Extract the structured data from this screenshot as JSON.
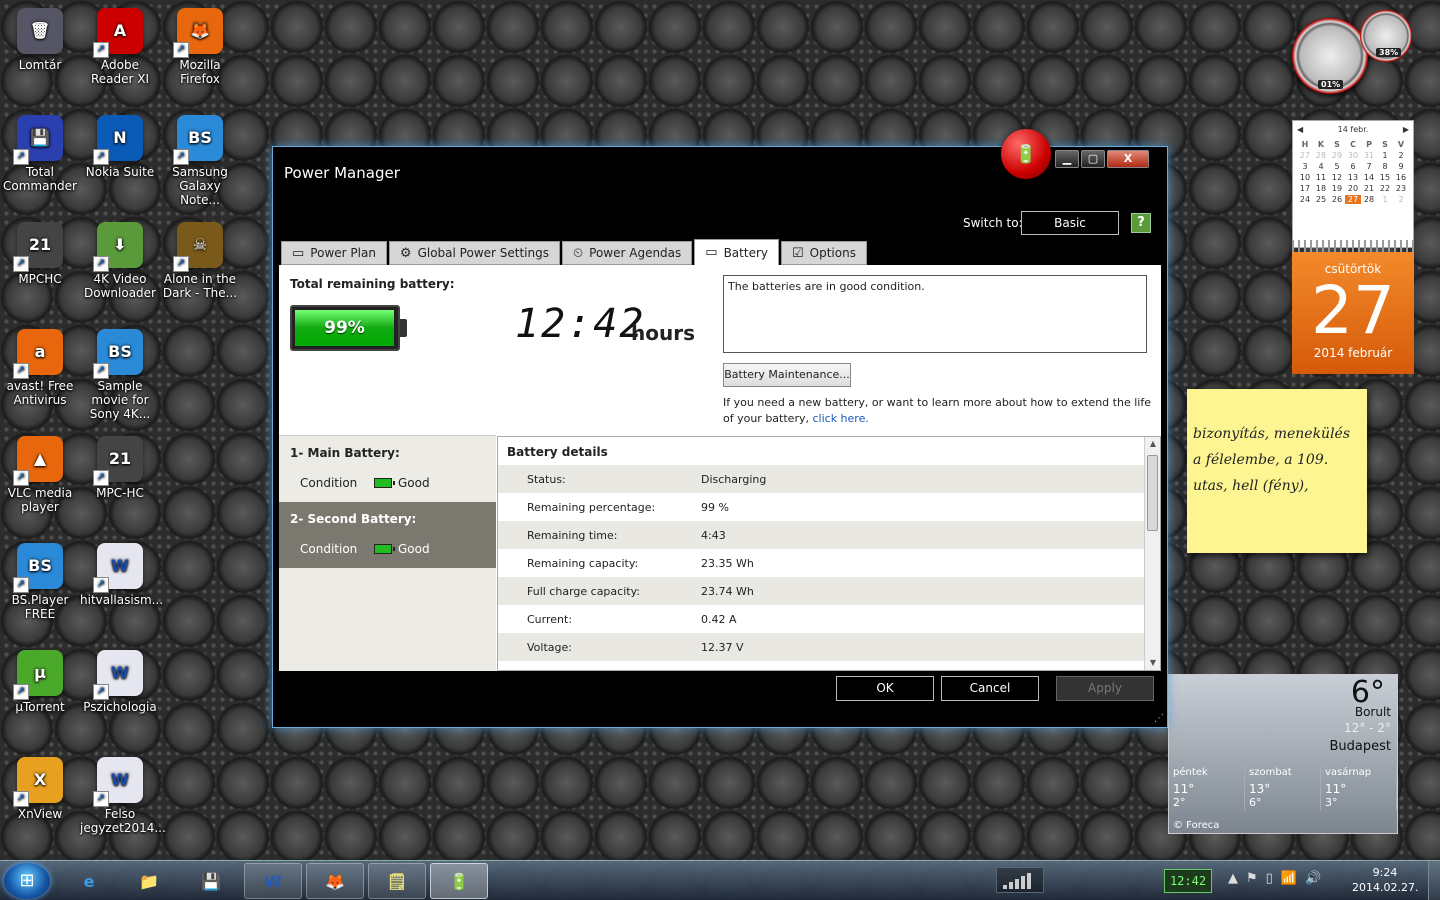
{
  "desktop_icons": [
    {
      "label": "Lomtár",
      "glyph": "🗑",
      "color": "#556"
    },
    {
      "label": "Adobe Reader XI",
      "glyph": "A",
      "color": "#c00"
    },
    {
      "label": "Mozilla Firefox",
      "glyph": "🦊",
      "color": "#e8670c"
    },
    {
      "label": "Total Commander",
      "glyph": "💾",
      "color": "#2a3fb0"
    },
    {
      "label": "Nokia Suite",
      "glyph": "N",
      "color": "#0a5ab8"
    },
    {
      "label": "Samsung Galaxy Note...",
      "glyph": "BS",
      "color": "#2a8ad8"
    },
    {
      "label": "MPCHC",
      "glyph": "21",
      "color": "#444"
    },
    {
      "label": "4K Video Downloader",
      "glyph": "⬇",
      "color": "#5a9a3a"
    },
    {
      "label": "Alone in the Dark - The...",
      "glyph": "☠",
      "color": "#7a5a1a"
    },
    {
      "label": "avast! Free Antivirus",
      "glyph": "a",
      "color": "#e8670c"
    },
    {
      "label": "Sample movie for Sony 4K...",
      "glyph": "BS",
      "color": "#2a8ad8"
    },
    {
      "label": "VLC media player",
      "glyph": "▲",
      "color": "#e8670c"
    },
    {
      "label": "MPC-HC",
      "glyph": "21",
      "color": "#444"
    },
    {
      "label": "BS.Player FREE",
      "glyph": "BS",
      "color": "#2a8ad8"
    },
    {
      "label": "hitvallasism...",
      "glyph": "W",
      "color": "#e6e6f0"
    },
    {
      "label": "µTorrent",
      "glyph": "µ",
      "color": "#4aa82a"
    },
    {
      "label": "Pszichologia",
      "glyph": "W",
      "color": "#e6e6f0"
    },
    {
      "label": "XnView",
      "glyph": "X",
      "color": "#e8a020"
    },
    {
      "label": "Felso jegyzet2014...",
      "glyph": "W",
      "color": "#e6e6f0"
    }
  ],
  "window": {
    "title": "Power Manager",
    "min": "▁",
    "max": "▢",
    "close": "X",
    "badge_glyph": "🔋",
    "switch_label": "Switch to:",
    "switch_value": "Basic",
    "help": "?",
    "tabs": [
      {
        "label": "Power Plan",
        "icon": "▭"
      },
      {
        "label": "Global Power Settings",
        "icon": "⚙"
      },
      {
        "label": "Power Agendas",
        "icon": "⏲"
      },
      {
        "label": "Battery",
        "icon": "▭"
      },
      {
        "label": "Options",
        "icon": "☑"
      }
    ],
    "active_tab": 3,
    "battery": {
      "total_label": "Total remaining battery:",
      "percent_text": "99%",
      "percent": 99,
      "time": "12:42",
      "time_unit": "hours",
      "message": "The batteries are in good condition.",
      "maintenance_button": "Battery Maintenance...",
      "info_text": "If you need a new battery, or want to learn more about how to extend the life of your battery,",
      "info_link": "click here."
    },
    "batteries": [
      {
        "name": "1- Main Battery:",
        "condition_label": "Condition",
        "condition": "Good"
      },
      {
        "name": "2- Second Battery:",
        "condition_label": "Condition",
        "condition": "Good"
      }
    ],
    "details": {
      "title": "Battery details",
      "rows": [
        {
          "key": "Status:",
          "value": "Discharging"
        },
        {
          "key": "Remaining percentage:",
          "value": "99 %"
        },
        {
          "key": "Remaining time:",
          "value": "4:43"
        },
        {
          "key": "Remaining capacity:",
          "value": "23.35 Wh"
        },
        {
          "key": "Full charge capacity:",
          "value": "23.74 Wh"
        },
        {
          "key": "Current:",
          "value": "0.42 A"
        },
        {
          "key": "Voltage:",
          "value": "12.37 V"
        }
      ]
    },
    "buttons": {
      "ok": "OK",
      "cancel": "Cancel",
      "apply": "Apply"
    }
  },
  "gadgets": {
    "cpu_meter": {
      "left_value": "01%",
      "right_value": "38%"
    },
    "calendar": {
      "month": "14 febr.",
      "prev": "◀",
      "next": "▶",
      "day_headers": [
        "H",
        "K",
        "S",
        "C",
        "P",
        "S",
        "V"
      ],
      "days": [
        {
          "d": "27",
          "m": true
        },
        {
          "d": "28",
          "m": true
        },
        {
          "d": "29",
          "m": true
        },
        {
          "d": "30",
          "m": true
        },
        {
          "d": "31",
          "m": true
        },
        {
          "d": "1"
        },
        {
          "d": "2"
        },
        {
          "d": "3"
        },
        {
          "d": "4"
        },
        {
          "d": "5"
        },
        {
          "d": "6"
        },
        {
          "d": "7"
        },
        {
          "d": "8"
        },
        {
          "d": "9"
        },
        {
          "d": "10"
        },
        {
          "d": "11"
        },
        {
          "d": "12"
        },
        {
          "d": "13"
        },
        {
          "d": "14"
        },
        {
          "d": "15"
        },
        {
          "d": "16"
        },
        {
          "d": "17"
        },
        {
          "d": "18"
        },
        {
          "d": "19"
        },
        {
          "d": "20"
        },
        {
          "d": "21"
        },
        {
          "d": "22"
        },
        {
          "d": "23"
        },
        {
          "d": "24"
        },
        {
          "d": "25"
        },
        {
          "d": "26"
        },
        {
          "d": "27",
          "today": true
        },
        {
          "d": "28"
        },
        {
          "d": "1",
          "m": true
        },
        {
          "d": "2",
          "m": true
        }
      ]
    },
    "day_card": {
      "weekday": "csütörtök",
      "day": "27",
      "month_year": "2014 február"
    },
    "sticky_note": "bizonyítás, menekülés a félelembe, a 109. utas, hell (fény),",
    "weather": {
      "temp": "6°",
      "condition": "Borult",
      "range": "12° - 2°",
      "city": "Budapest",
      "forecast": [
        {
          "day": "péntek",
          "hi": "11°",
          "lo": "2°"
        },
        {
          "day": "szombat",
          "hi": "13°",
          "lo": "6°"
        },
        {
          "day": "vasárnap",
          "hi": "11°",
          "lo": "3°"
        }
      ],
      "brand": "© Foreca"
    }
  },
  "taskbar": {
    "start_glyph": "⊞",
    "buttons": [
      {
        "name": "internet-explorer",
        "glyph": "e",
        "color": "#3a9ae8"
      },
      {
        "name": "explorer",
        "glyph": "📁",
        "color": "#e8c050"
      },
      {
        "name": "total-commander",
        "glyph": "💾",
        "color": "#2a3fb0"
      },
      {
        "name": "word",
        "glyph": "W",
        "color": "#2a5ab8"
      },
      {
        "name": "firefox",
        "glyph": "🦊",
        "color": "#e8670c"
      },
      {
        "name": "sticky-notes",
        "glyph": "🗒",
        "color": "#e8e080"
      },
      {
        "name": "power-manager",
        "glyph": "🔋",
        "color": "#d00"
      }
    ],
    "tray_badge": "12:42",
    "tray_icons": [
      "▲",
      "⚑",
      "▯",
      "📶",
      "🔊"
    ],
    "time": "9:24",
    "date": "2014.02.27."
  }
}
